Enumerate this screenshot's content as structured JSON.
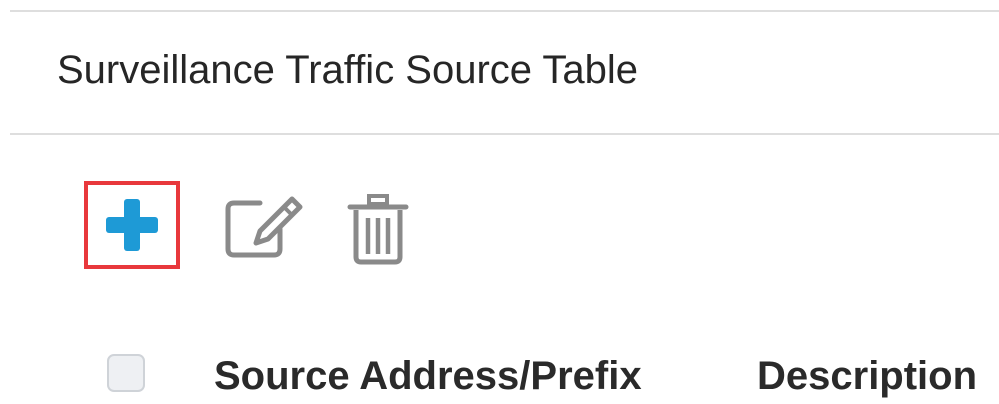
{
  "page": {
    "title": "Surveillance Traffic Source Table"
  },
  "toolbar": {
    "add": {
      "icon": "plus-icon",
      "color": "#1e9ad6",
      "highlight_color": "#e8383c"
    },
    "edit": {
      "icon": "edit-icon",
      "color": "#8a8a8a"
    },
    "delete": {
      "icon": "trash-icon",
      "color": "#8a8a8a"
    }
  },
  "table": {
    "columns": [
      {
        "label": "Source Address/Prefix"
      },
      {
        "label": "Description"
      }
    ],
    "select_all_checked": false
  }
}
